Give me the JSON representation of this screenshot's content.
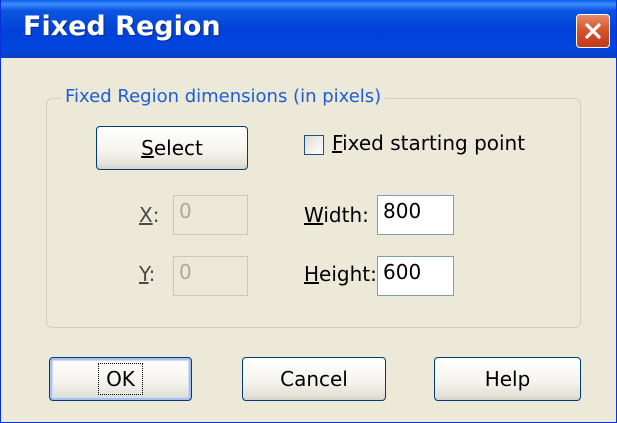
{
  "window": {
    "title": "Fixed Region"
  },
  "group": {
    "legend": "Fixed Region dimensions (in pixels)"
  },
  "select_button": {
    "before": "",
    "key": "S",
    "after": "elect"
  },
  "fixed_start": {
    "checked": false,
    "key": "F",
    "after": "ixed starting point"
  },
  "x_field": {
    "key": "X",
    "after": ":",
    "value": "0"
  },
  "y_field": {
    "key": "Y",
    "after": ":",
    "value": "0"
  },
  "width_field": {
    "key": "W",
    "after": "idth:",
    "value": "800"
  },
  "height_field": {
    "key": "H",
    "after": "eight:",
    "value": "600"
  },
  "buttons": {
    "ok": "OK",
    "cancel": "Cancel",
    "help": "Help"
  },
  "colors": {
    "titlebar": "#0046e0",
    "face": "#ece9d8",
    "legend": "#1d5dd5",
    "close": "#d6562c"
  }
}
